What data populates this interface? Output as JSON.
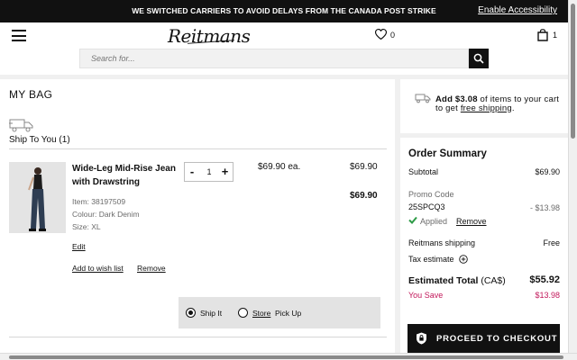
{
  "promo": {
    "message": "WE SWITCHED CARRIERS TO AVOID DELAYS FROM THE CANADA POST STRIKE",
    "accessibility_link": "Enable Accessibility"
  },
  "header": {
    "logo_text": "Reitmans",
    "wishlist_count": "0",
    "bag_count": "1",
    "search_placeholder": "Search for..."
  },
  "bag": {
    "title": "MY BAG",
    "ship_section_title": "Ship To You (1)",
    "item": {
      "name": "Wide-Leg Mid-Rise Jean with Drawstring",
      "item_number": "Item: 38197509",
      "colour": "Colour: Dark Denim",
      "size": "Size: XL",
      "edit_label": "Edit",
      "wishlist_label": "Add to wish list",
      "remove_label": "Remove",
      "qty_minus": "-",
      "quantity": "1",
      "qty_plus": "+",
      "unit_price": "$69.90 ea.",
      "line_price": "$69.90",
      "line_total": "$69.90"
    },
    "fulfillment": {
      "ship_it_label": "Ship It",
      "store_link": "Store",
      "pickup_label": "Pick Up",
      "selected": "ship_it"
    }
  },
  "free_shipping": {
    "prefix": "Add $3.08",
    "middle": " of items to your cart to get ",
    "link": "free shipping",
    "suffix": "."
  },
  "summary": {
    "title": "Order Summary",
    "subtotal_label": "Subtotal",
    "subtotal_value": "$69.90",
    "promo_label": "Promo Code",
    "promo_code": "25SPCQ3",
    "promo_value": "- $13.98",
    "applied_label": "Applied",
    "remove_label": "Remove",
    "shipping_label": "Reitmans shipping",
    "shipping_value": "Free",
    "tax_label": "Tax estimate",
    "total_label": "Estimated Total",
    "total_currency": " (CA$)",
    "total_value": "$55.92",
    "savings_label": "You Save",
    "savings_value": "$13.98",
    "checkout_label": "PROCEED TO CHECKOUT"
  },
  "colors": {
    "accent": "#111111",
    "savings": "#c2185b",
    "applied_check": "#2e9b47"
  },
  "icons": [
    "menu-icon",
    "heart-icon",
    "shopping-bag-icon",
    "search-icon",
    "truck-icon",
    "check-icon",
    "plus-circle-icon",
    "lock-icon"
  ]
}
